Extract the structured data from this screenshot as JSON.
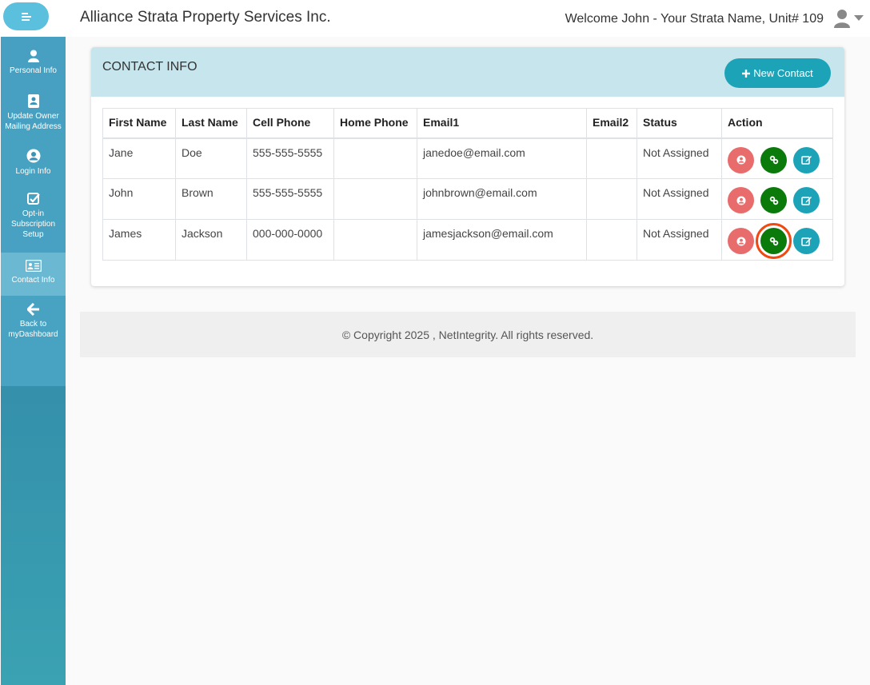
{
  "header": {
    "brand": "Alliance Strata Property Services Inc.",
    "welcome": "Welcome John - Your Strata Name, Unit# 109"
  },
  "sidebar": {
    "items": [
      {
        "label": "Personal Info",
        "icon": "user-icon"
      },
      {
        "label": "Update Owner Mailing Address",
        "icon": "address-book-icon"
      },
      {
        "label": "Login Info",
        "icon": "user-circle-icon"
      },
      {
        "label": "Opt-in Subscription Setup",
        "icon": "check-square-icon"
      },
      {
        "label": "Contact Info",
        "icon": "id-card-icon"
      },
      {
        "label": "Back to myDashboard",
        "icon": "arrow-left-icon"
      }
    ]
  },
  "card": {
    "title": "CONTACT INFO",
    "new_contact_label": "New Contact"
  },
  "table": {
    "headers": [
      "First Name",
      "Last Name",
      "Cell Phone",
      "Home Phone",
      "Email1",
      "Email2",
      "Status",
      "Action"
    ],
    "rows": [
      {
        "first": "Jane",
        "last": "Doe",
        "cell": "555-555-5555",
        "home": "",
        "email1": "janedoe@email.com",
        "email2": "",
        "status": "Not Assigned"
      },
      {
        "first": "John",
        "last": "Brown",
        "cell": "555-555-5555",
        "home": "",
        "email1": "johnbrown@email.com",
        "email2": "",
        "status": "Not Assigned"
      },
      {
        "first": "James",
        "last": "Jackson",
        "cell": "000-000-0000",
        "home": "",
        "email1": "jamesjackson@email.com",
        "email2": "",
        "status": "Not Assigned"
      }
    ]
  },
  "footer": {
    "copyright": "© Copyright 2025 , NetIntegrity. All rights reserved."
  },
  "colors": {
    "accent": "#1ca3b8",
    "danger": "#e86c6c",
    "success": "#0a7a0a",
    "highlight": "#f04a14",
    "card_header": "#c6e5ec"
  }
}
